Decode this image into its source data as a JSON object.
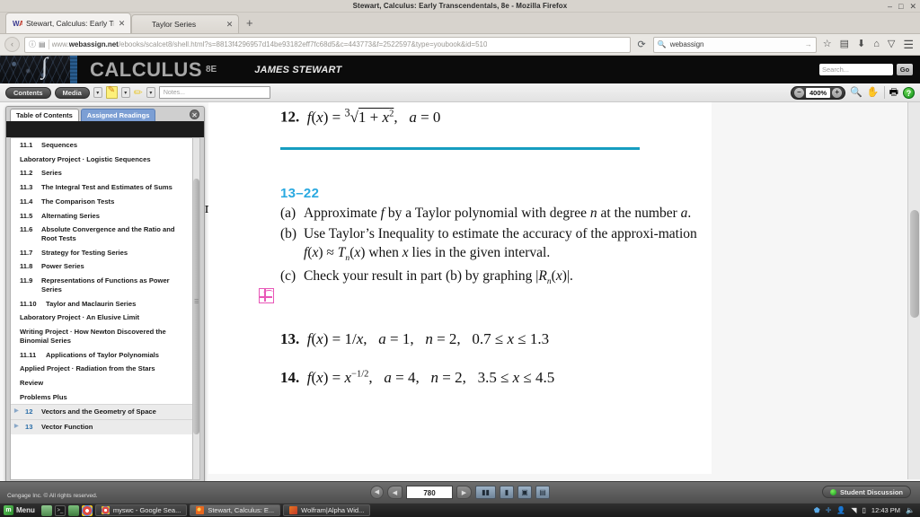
{
  "window": {
    "title": "Stewart, Calculus: Early Transcendentals, 8e - Mozilla Firefox",
    "minimize": "–",
    "maximize": "□",
    "close": "✕"
  },
  "tabs": [
    {
      "label": "Stewart, Calculus: Early Tra",
      "close": "✕",
      "favicon": "webassign-icon",
      "active": true
    },
    {
      "label": "Taylor Series",
      "close": "✕",
      "favicon": "taylor-series-icon",
      "active": false
    }
  ],
  "new_tab_label": "+",
  "navbar": {
    "back": "‹",
    "forward": "›",
    "identity_icon": "ⓘ",
    "reader_icon": "▤",
    "url_prefix": "www.",
    "url_domain": "webassign.net",
    "url_path": "/ebooks/scalcet8/shell.html?s=8813f4296957d14be93182eff7fc68d5&c=443773&f=2522597&type=youbook&id=510",
    "reload": "⟳",
    "search_value": "webassign",
    "search_go": "→",
    "bookmark_icon": "☆",
    "library_icon": "▤",
    "download_icon": "⬇",
    "home_icon": "⌂",
    "pocket_icon": "▽",
    "menu_icon": "☰"
  },
  "ebook_header": {
    "title": "CALCULUS",
    "edition": "8E",
    "author": "JAMES STEWART",
    "search_placeholder": "Search...",
    "go_label": "Go"
  },
  "ebook_tools": {
    "contents_label": "Contents",
    "media_label": "Media",
    "dropdown_glyph": "▾",
    "notes_placeholder": "Notes...",
    "zoom_minus": "–",
    "zoom_value": "400%",
    "zoom_plus": "+",
    "magnify_icon": "🔍",
    "hand_icon": "✋",
    "print_icon": "🖨",
    "help_icon": "?"
  },
  "toc": {
    "tab_contents": "Table of Contents",
    "tab_assigned": "Assigned Readings",
    "close_glyph": "✕",
    "items": [
      {
        "num": "11.1",
        "text": "Sequences"
      },
      {
        "num": "",
        "text": "Laboratory Project · Logistic Sequences"
      },
      {
        "num": "11.2",
        "text": "Series"
      },
      {
        "num": "11.3",
        "text": "The Integral Test and Estimates of Sums"
      },
      {
        "num": "11.4",
        "text": "The Comparison Tests"
      },
      {
        "num": "11.5",
        "text": "Alternating Series"
      },
      {
        "num": "11.6",
        "text": "Absolute Convergence and the Ratio and Root Tests"
      },
      {
        "num": "11.7",
        "text": "Strategy for Testing Series"
      },
      {
        "num": "11.8",
        "text": "Power Series"
      },
      {
        "num": "11.9",
        "text": "Representations of Functions as Power Series"
      },
      {
        "num": "11.10",
        "text": "Taylor and Maclaurin Series"
      },
      {
        "num": "",
        "text": "Laboratory Project · An Elusive Limit"
      },
      {
        "num": "",
        "text": "Writing Project · How Newton Discovered the Binomial Series"
      },
      {
        "num": "11.11",
        "text": "Applications of Taylor Polynomials"
      },
      {
        "num": "",
        "text": "Applied Project · Radiation from the Stars"
      },
      {
        "num": "",
        "text": "Review"
      },
      {
        "num": "",
        "text": "Problems Plus"
      }
    ],
    "chapters": [
      {
        "arrow": "▶",
        "num": "12",
        "text": "Vectors and the Geometry of Space"
      },
      {
        "arrow": "▶",
        "num": "13",
        "text": "Vector Function"
      }
    ]
  },
  "book_page": {
    "left_peek": "n.",
    "problem_12": {
      "number": "12.",
      "body": "f(x) = ∛1 + x²,   a = 0"
    },
    "section_heading": "13–22",
    "instructions": [
      {
        "tag": "(a)",
        "text": "Approximate f by a Taylor polynomial with degree n at the number a."
      },
      {
        "tag": "(b)",
        "text": "Use Taylor's Inequality to estimate the accuracy of the approximation f(x) ≈ Tn(x) when x lies in the given interval."
      },
      {
        "tag": "(c)",
        "text": "Check your result in part (b) by graphing |Rn(x)|."
      }
    ],
    "problem_13": {
      "number": "13.",
      "body": "f(x) = 1/x,   a = 1,   n = 2,   0.7 ⩽ x ⩽ 1.3"
    },
    "problem_14": {
      "number": "14.",
      "body": "f(x) = x^(−1/2),   a = 4,   n = 2,   3.5 ⩽ x ⩽ 4.5"
    }
  },
  "ebook_footer": {
    "first_glyph": "◀",
    "prev_glyph": "◀",
    "page_number": "780",
    "next_glyph": "▶",
    "view_single": "▮",
    "view_double": "▮▮",
    "view_fit": "▣",
    "view_width": "▤",
    "view_scroll": "▥",
    "copyright": "Cengage Inc. © All rights reserved.",
    "student_discussion": "Student Discussion"
  },
  "taskbar": {
    "menu_label": "Menu",
    "menu_icon_glyph": "m",
    "quick_icons": [
      "files-icon",
      "terminal-icon",
      "folder-icon",
      "chrome-icon"
    ],
    "terminal_glyph": ">_",
    "windows": [
      {
        "label": "myswc - Google Sea...",
        "icon": "chrome-icon",
        "active": false
      },
      {
        "label": "Stewart, Calculus: E...",
        "icon": "firefox-icon",
        "active": true
      },
      {
        "label": "Wolfram|Alpha Wid...",
        "icon": "wolfram-icon",
        "active": false
      }
    ],
    "tray": {
      "shield": "🛡",
      "bluetooth": "✛",
      "user": "👤",
      "wifi": "▲",
      "battery": "▯",
      "clock": "12:43 PM",
      "volume": "🔊"
    }
  }
}
